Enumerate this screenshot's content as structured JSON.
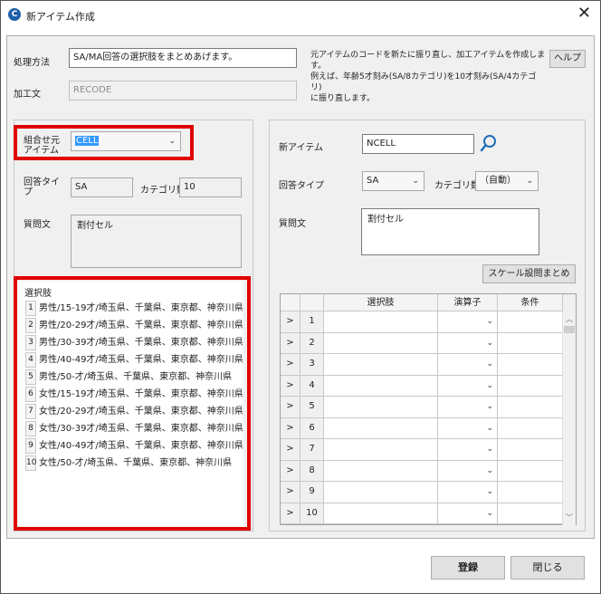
{
  "window": {
    "title": "新アイテム作成",
    "close_glyph": "✕",
    "app_icon_glyph": "C"
  },
  "top": {
    "method_label": "処理方法",
    "method_value": "SA/MA回答の選択肢をまとめあげます。",
    "process_label": "加工文",
    "process_value": "RECODE",
    "description": [
      "元アイテムのコードを新たに振り直し、加工アイテムを作成します。",
      "例えば、年齢5才刻み(SA/8カテゴリ)を10才刻み(SA/4カテゴリ)",
      "に振り直します。"
    ],
    "help_button": "ヘルプ"
  },
  "left": {
    "source_item_label": "組合せ元\nアイテム",
    "source_item_value": "CELL",
    "answer_type_label": "回答タイ\nプ",
    "answer_type_value": "SA",
    "category_count_label": "カテゴリ数",
    "category_count_value": "10",
    "question_label": "質問文",
    "question_value": "割付セル",
    "choices_label": "選択肢",
    "choices": [
      {
        "num": "1",
        "text": "男性/15-19才/埼玉県、千葉県、東京都、神奈川県"
      },
      {
        "num": "2",
        "text": "男性/20-29才/埼玉県、千葉県、東京都、神奈川県"
      },
      {
        "num": "3",
        "text": "男性/30-39才/埼玉県、千葉県、東京都、神奈川県"
      },
      {
        "num": "4",
        "text": "男性/40-49才/埼玉県、千葉県、東京都、神奈川県"
      },
      {
        "num": "5",
        "text": "男性/50-才/埼玉県、千葉県、東京都、神奈川県"
      },
      {
        "num": "6",
        "text": "女性/15-19才/埼玉県、千葉県、東京都、神奈川県"
      },
      {
        "num": "7",
        "text": "女性/20-29才/埼玉県、千葉県、東京都、神奈川県"
      },
      {
        "num": "8",
        "text": "女性/30-39才/埼玉県、千葉県、東京都、神奈川県"
      },
      {
        "num": "9",
        "text": "女性/40-49才/埼玉県、千葉県、東京都、神奈川県"
      },
      {
        "num": "10",
        "text": "女性/50-才/埼玉県、千葉県、東京都、神奈川県"
      }
    ]
  },
  "right": {
    "new_item_label": "新アイテム",
    "new_item_value": "NCELL",
    "answer_type_label": "回答タイプ",
    "answer_type_value": "SA",
    "category_count_label": "カテゴリ数",
    "category_count_value": "（自動）",
    "question_label": "質問文",
    "question_value": "割付セル",
    "scale_button": "スケール設問まとめ",
    "grid": {
      "headers": [
        "選択肢",
        "演算子",
        "条件"
      ],
      "row_marker": ">",
      "rows": [
        "1",
        "2",
        "3",
        "4",
        "5",
        "6",
        "7",
        "8",
        "9",
        "10"
      ]
    }
  },
  "footer": {
    "register_button": "登録",
    "close_button": "閉じる"
  },
  "colors": {
    "highlight": "#e00000",
    "selection": "#3399ff",
    "search_icon": "#1e6fb8"
  }
}
